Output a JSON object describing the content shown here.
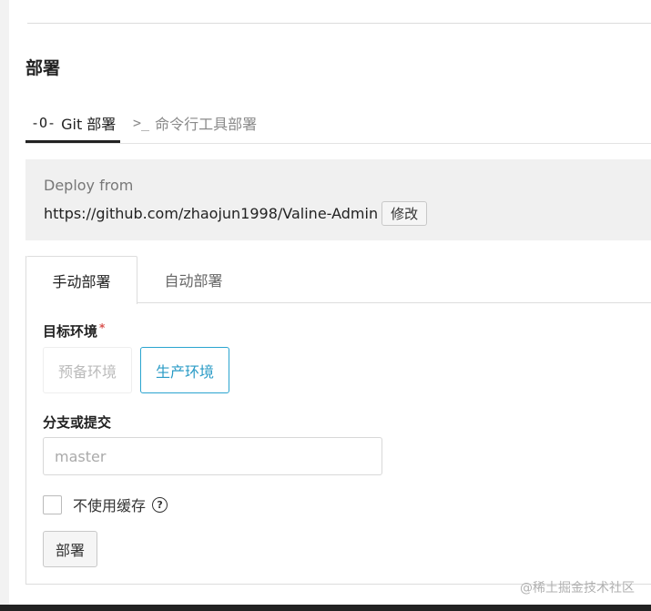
{
  "section": {
    "title": "部署"
  },
  "main_tabs": [
    {
      "icon": "git-icon",
      "icon_glyph": "-O-",
      "label": "Git 部署",
      "active": true
    },
    {
      "icon": "terminal-icon",
      "icon_glyph": ">_",
      "label": "命令行工具部署",
      "active": false
    }
  ],
  "deploy_source": {
    "heading": "Deploy from",
    "repo_url": "https://github.com/zhaojun1998/Valine-Admin",
    "edit_label": "修改"
  },
  "sub_tabs": [
    {
      "label": "手动部署",
      "active": true
    },
    {
      "label": "自动部署",
      "active": false
    }
  ],
  "form": {
    "env_label": "目标环境",
    "required_mark": "*",
    "env_options": [
      {
        "label": "预备环境",
        "state": "disabled"
      },
      {
        "label": "生产环境",
        "state": "selected"
      }
    ],
    "branch_label": "分支或提交",
    "branch_placeholder": "master",
    "branch_value": "",
    "no_cache_label": "不使用缓存",
    "no_cache_checked": false,
    "help_glyph": "?",
    "deploy_button": "部署"
  },
  "watermark": "@稀土掘金技术社区",
  "colors": {
    "accent": "#2a9bc6",
    "required": "#d9534f",
    "deploy_bg": "#f0f0f0"
  }
}
